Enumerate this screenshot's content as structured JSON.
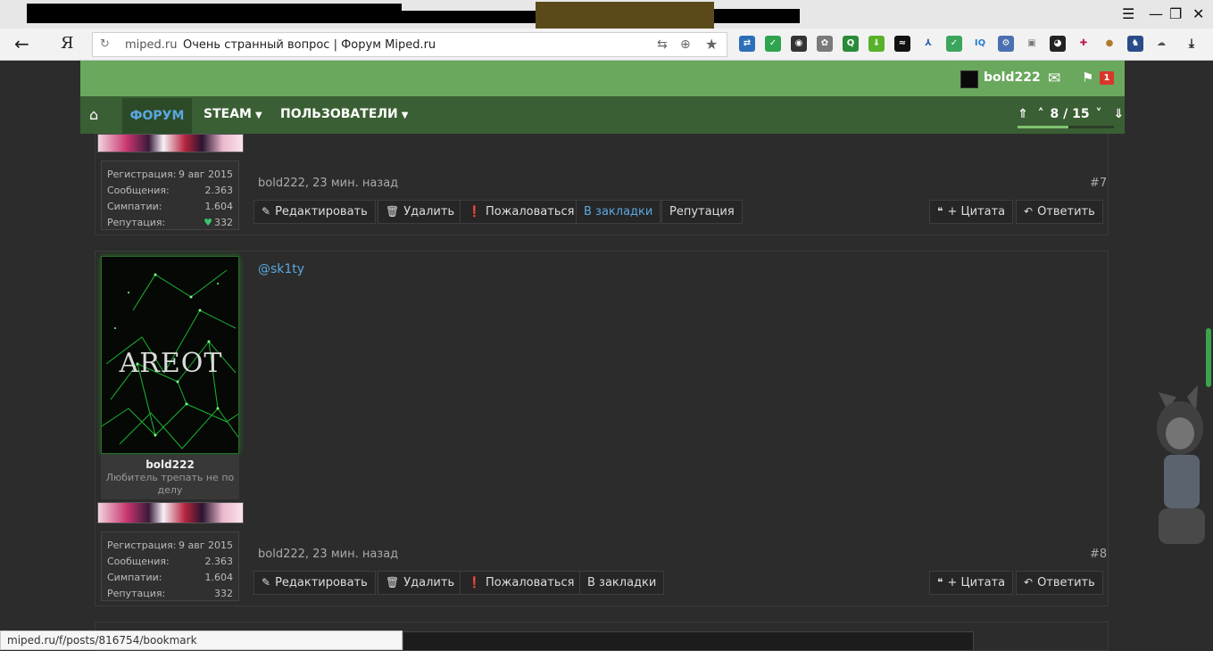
{
  "browser": {
    "url_domain": "miped.ru",
    "url_title": "Очень странный вопрос | Форум Miped.ru",
    "yandex_glyph": "Я",
    "status_url": "miped.ru/f/posts/816754/bookmark"
  },
  "header": {
    "username": "bold222",
    "alert_count": "1"
  },
  "nav": {
    "forum": "ФОРУМ",
    "steam": "STEAM",
    "users": "ПОЛЬЗОВАТЕЛИ",
    "pager": "8 / 15",
    "pager_progress": 0.53
  },
  "labels": {
    "reg": "Регистрация:",
    "msgs": "Сообщения:",
    "likes": "Симпатии:",
    "rep": "Репутация:"
  },
  "posts": [
    {
      "reg": "9 авг 2015",
      "msgs": "2.363",
      "likes": "1.604",
      "rep": "332",
      "meta": "bold222, 23 мин. назад",
      "num": "#7",
      "buttons": [
        "Редактировать",
        "Удалить",
        "Пожаловаться",
        "В закладки",
        "Репутация"
      ],
      "quote": "+ Цитата",
      "reply": "Ответить"
    },
    {
      "author": "bold222",
      "author_title": "Любитель трепать не по делу",
      "avatar_text": "AREOT",
      "mention": "@sk1ty",
      "reg": "9 авг 2015",
      "msgs": "2.363",
      "likes": "1.604",
      "rep": "332",
      "meta": "bold222, 23 мин. назад",
      "num": "#8",
      "buttons": [
        "Редактировать",
        "Удалить",
        "Пожаловаться",
        "В закладки"
      ],
      "quote": "+ Цитата",
      "reply": "Ответить"
    }
  ],
  "colors": {
    "green_header": "#6aa85d",
    "nav_bg": "#3b5f34",
    "link_blue": "#5aa7e0",
    "badge_red": "#d9362b"
  }
}
